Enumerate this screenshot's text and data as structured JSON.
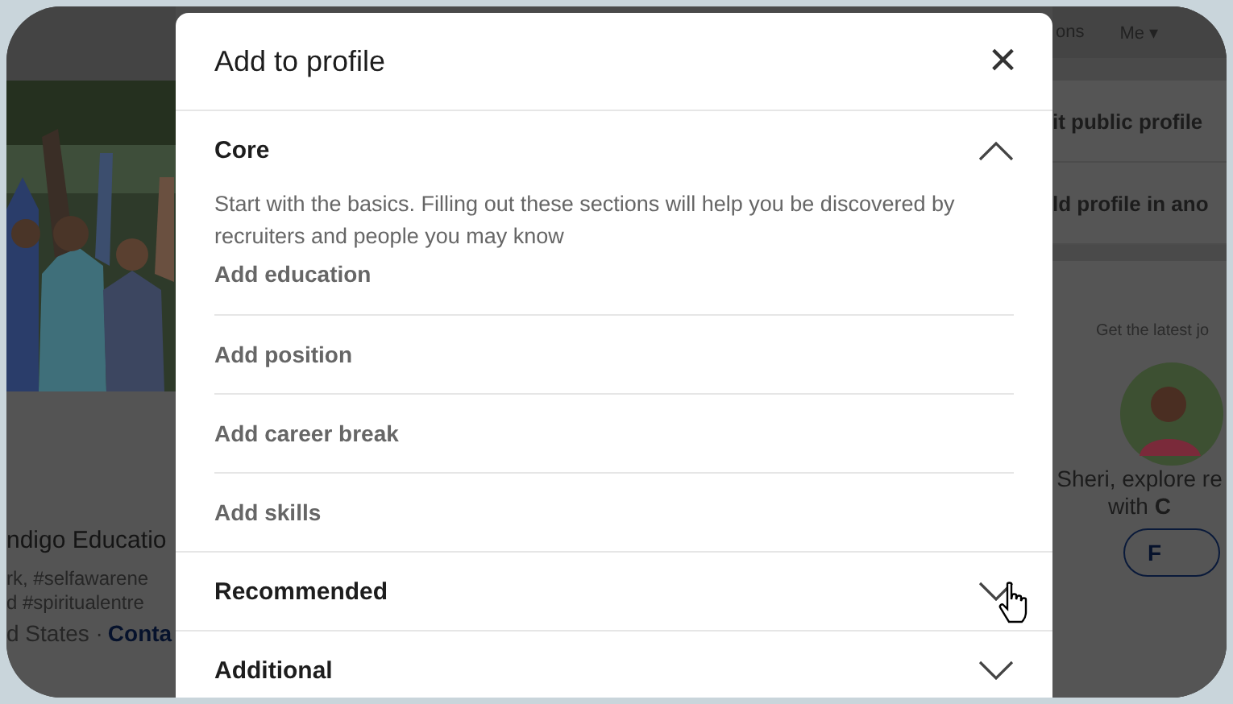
{
  "background_page": {
    "nav_items": [
      "ons",
      "Me ▾"
    ],
    "left_card": {
      "picture": {
        "kind": "picture"
      },
      "name": "ndigo Educatio",
      "headline_lines": [
        "rk, #selfawarene",
        "d #spiritualentre"
      ],
      "location": "d States ·",
      "contact_link": "Conta"
    },
    "right_links": [
      "it public profile",
      "ld profile in ano"
    ],
    "promo": {
      "caption": "Get the latest jo",
      "message_lines": [
        "Sheri, explore re",
        "with **C**"
      ],
      "button": "F"
    }
  },
  "modal": {
    "title": "Add to profile",
    "close": "×",
    "sections": [
      {
        "title": "Core",
        "expanded": true,
        "description": "Start with the basics. Filling out these sections will help you be discovered by recruiters and people you may know",
        "items": [
          "Add education",
          "Add position",
          "Add career break",
          "Add skills"
        ]
      },
      {
        "title": "Recommended",
        "expanded": false,
        "hovered": true
      },
      {
        "title": "Additional",
        "expanded": false,
        "hovered": false
      }
    ]
  }
}
